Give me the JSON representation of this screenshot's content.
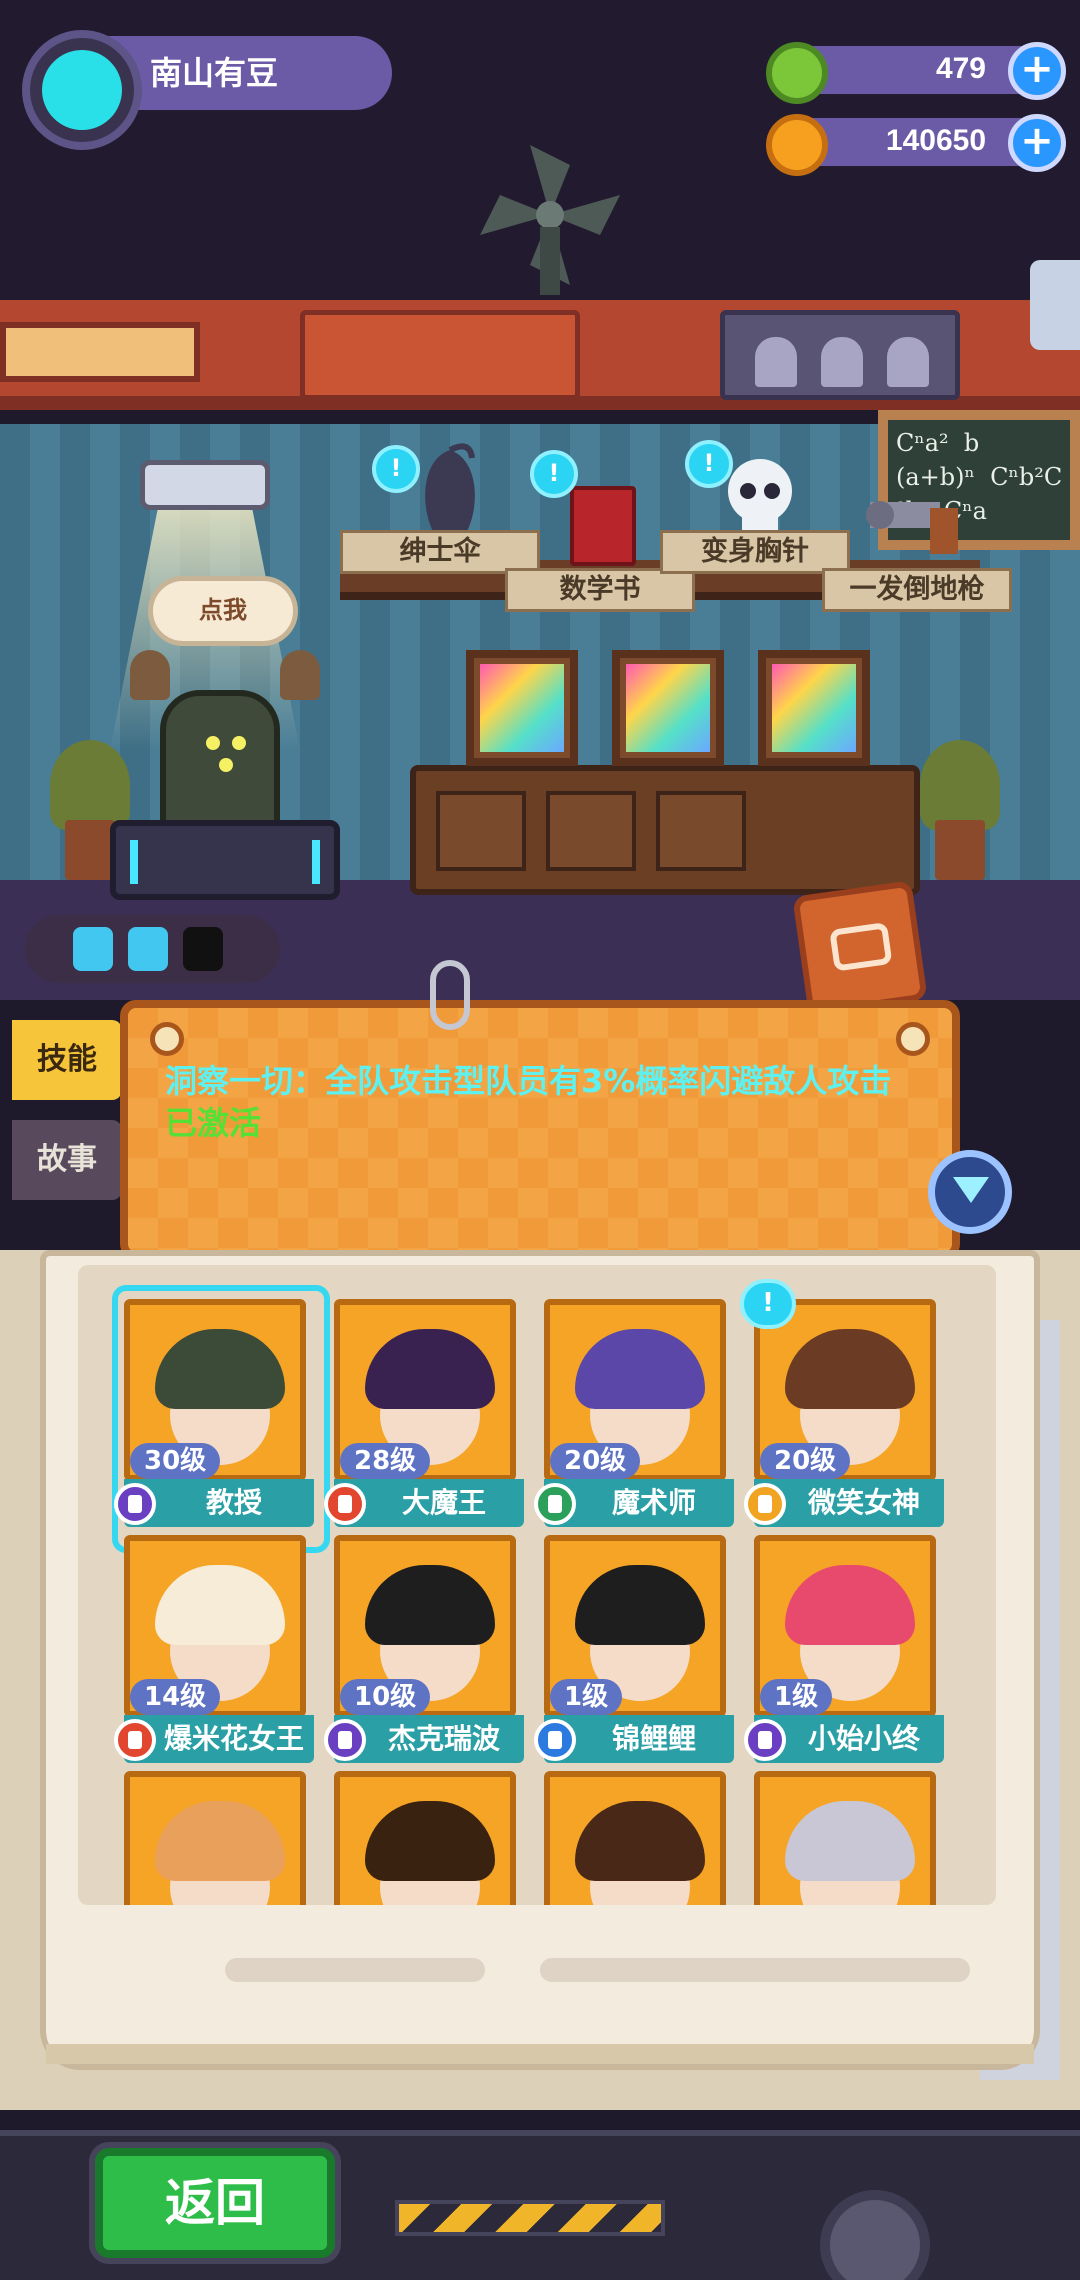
{
  "player": {
    "name": "南山有豆"
  },
  "currencies": [
    {
      "id": "gem",
      "value": "479",
      "color": "#7cc63a"
    },
    {
      "id": "coin",
      "value": "140650",
      "color": "#f7a020"
    }
  ],
  "icons": {
    "plus": "+",
    "alert": "!"
  },
  "lab": {
    "chalkboard_text": "Cⁿa²  b\n(a+b)ⁿ  Cⁿb²C\n²b   Cⁿa",
    "speech": "点我",
    "items": [
      {
        "label": "绅士伞"
      },
      {
        "label": "数学书"
      },
      {
        "label": "变身胸针"
      },
      {
        "label": "一发倒地枪"
      }
    ],
    "energy_cells": 3,
    "energy_filled": 2
  },
  "tabs": [
    {
      "label": "技能",
      "active": true
    },
    {
      "label": "故事",
      "active": false
    }
  ],
  "skill": {
    "text": "洞察一切：全队攻击型队员有3%概率闪避敌人攻击",
    "status": "已激活"
  },
  "characters": [
    {
      "name": "教授",
      "level": "30级",
      "badge_color": "#6a3fc2",
      "hair": "#3c4a38",
      "selected": true,
      "alert": false
    },
    {
      "name": "大魔王",
      "level": "28级",
      "badge_color": "#e2462e",
      "hair": "#3a2250",
      "selected": false,
      "alert": false
    },
    {
      "name": "魔术师",
      "level": "20级",
      "badge_color": "#2aa05a",
      "hair": "#5a47a8",
      "selected": false,
      "alert": false
    },
    {
      "name": "微笑女神",
      "level": "20级",
      "badge_color": "#f0a422",
      "hair": "#6b3b24",
      "selected": false,
      "alert": true
    },
    {
      "name": "爆米花女王",
      "level": "14级",
      "badge_color": "#e2462e",
      "hair": "#f6ecd8",
      "selected": false,
      "alert": false
    },
    {
      "name": "杰克瑞波",
      "level": "10级",
      "badge_color": "#6a3fc2",
      "hair": "#1e1e1e",
      "selected": false,
      "alert": false
    },
    {
      "name": "锦鲤鲤",
      "level": "1级",
      "badge_color": "#2a7ae0",
      "hair": "#1e1e1e",
      "selected": false,
      "alert": false
    },
    {
      "name": "小始小终",
      "level": "1级",
      "badge_color": "#6a3fc2",
      "hair": "#e84a6e",
      "selected": false,
      "alert": false
    },
    {
      "name": "",
      "level": "",
      "badge_color": "",
      "hair": "#e8a05a",
      "selected": false,
      "alert": false
    },
    {
      "name": "",
      "level": "",
      "badge_color": "",
      "hair": "#3a2210",
      "selected": false,
      "alert": false
    },
    {
      "name": "",
      "level": "",
      "badge_color": "",
      "hair": "#4a2818",
      "selected": false,
      "alert": false
    },
    {
      "name": "",
      "level": "",
      "badge_color": "",
      "hair": "#c9c6d6",
      "selected": false,
      "alert": false
    }
  ],
  "back_button": {
    "label": "返回"
  }
}
